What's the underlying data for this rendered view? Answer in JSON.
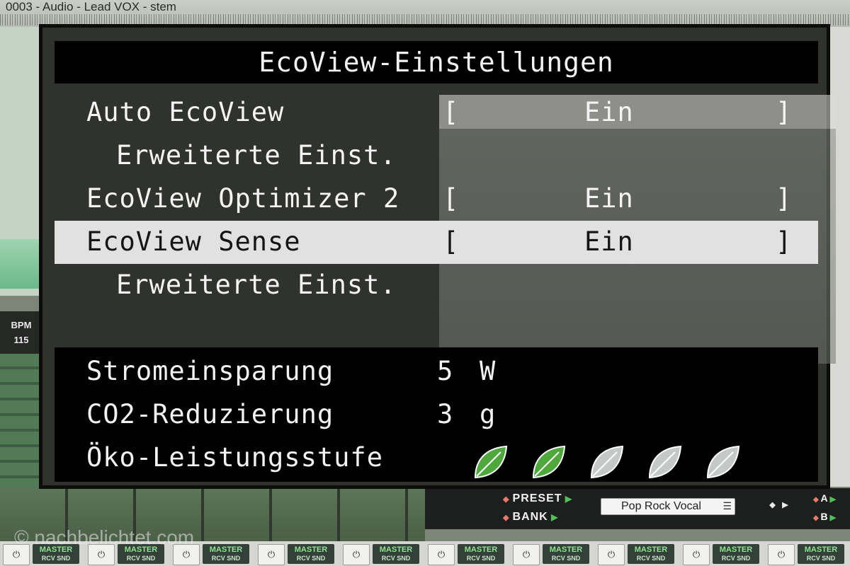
{
  "background": {
    "top_track_title": "0003 - Audio - Lead VOX - stem",
    "bpm_label": "BPM",
    "bpm_value": "115",
    "preset_label": "PRESET",
    "bank_label": "BANK",
    "preset_name": "Pop Rock Vocal",
    "a_label": "A",
    "b_label": "B",
    "master_label": "MASTER",
    "master_sub": "RCV SND",
    "power_glyph": "⏻",
    "watermark": "© nachbelichtet.com"
  },
  "osd": {
    "title": "EcoView-Einstellungen",
    "menu": [
      {
        "label": "Auto EcoView",
        "value": "Ein",
        "has_value": true,
        "sub": false,
        "selected": false
      },
      {
        "label": "Erweiterte Einst.",
        "value": "",
        "has_value": false,
        "sub": true,
        "selected": false
      },
      {
        "label": "EcoView Optimizer 2",
        "value": "Ein",
        "has_value": true,
        "sub": false,
        "selected": false
      },
      {
        "label": "EcoView Sense",
        "value": "Ein",
        "has_value": true,
        "sub": false,
        "selected": true
      },
      {
        "label": "Erweiterte Einst.",
        "value": "",
        "has_value": false,
        "sub": true,
        "selected": false
      }
    ],
    "stats": {
      "power_label": "Stromeinsparung",
      "power_value": "5",
      "power_unit": "W",
      "co2_label": "CO2-Reduzierung",
      "co2_value": "3",
      "co2_unit": "g",
      "eco_label": "Öko-Leistungsstufe",
      "eco_level": 2,
      "eco_max": 5
    },
    "colors": {
      "leaf_active": "#4fa83c",
      "leaf_inactive": "#c4c8c6",
      "selection": "#e1e1e1"
    }
  }
}
